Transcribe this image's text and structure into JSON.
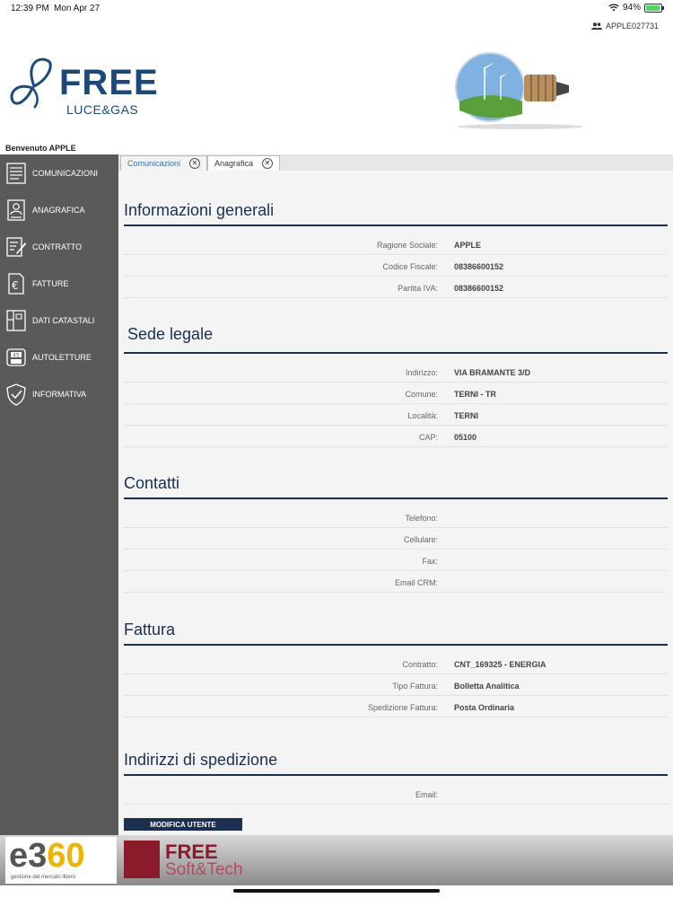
{
  "status": {
    "time": "12:39 PM",
    "date": "Mon Apr 27",
    "battery": "94%",
    "battery_level": 0.94
  },
  "user": {
    "code": "APPLE027731",
    "welcome": "Benvenuto APPLE"
  },
  "brand": {
    "primary": "#1b4a7a",
    "sidebar_bg": "#5a5a5a",
    "heading": "#1b2f4f"
  },
  "sidebar": {
    "items": [
      {
        "label": "COMUNICAZIONI",
        "icon": "document-list-icon"
      },
      {
        "label": "ANAGRAFICA",
        "icon": "id-card-icon"
      },
      {
        "label": "CONTRATTO",
        "icon": "contract-edit-icon"
      },
      {
        "label": "FATTURE",
        "icon": "euro-invoice-icon"
      },
      {
        "label": "DATI CATASTALI",
        "icon": "building-map-icon"
      },
      {
        "label": "AUTOLETTURE",
        "icon": "meter-icon"
      },
      {
        "label": "INFORMATIVA",
        "icon": "shield-check-icon"
      }
    ]
  },
  "tabs": [
    {
      "label": "Comunicazioni"
    },
    {
      "label": "Anagrafica"
    }
  ],
  "sections": {
    "generali": {
      "title": "Informazioni generali",
      "rows": [
        {
          "key": "Ragione Sociale:",
          "value": "APPLE"
        },
        {
          "key": "Codice Fiscale:",
          "value": "08386600152"
        },
        {
          "key": "Partita IVA:",
          "value": "08386600152"
        }
      ]
    },
    "sede": {
      "title": "Sede legale",
      "rows": [
        {
          "key": "Indirizzo:",
          "value": "VIA BRAMANTE 3/D"
        },
        {
          "key": "Comune:",
          "value": "TERNI - TR"
        },
        {
          "key": "Località:",
          "value": "TERNI"
        },
        {
          "key": "CAP:",
          "value": "05100"
        }
      ]
    },
    "contatti": {
      "title": "Contatti",
      "rows": [
        {
          "key": "Telefono:",
          "value": ""
        },
        {
          "key": "Cellulare:",
          "value": ""
        },
        {
          "key": "Fax:",
          "value": ""
        },
        {
          "key": "Email CRM:",
          "value": ""
        }
      ]
    },
    "fattura": {
      "title": "Fattura",
      "rows": [
        {
          "key": "Contratto:",
          "value": "CNT_169325 - ENERGIA"
        },
        {
          "key": "Tipo Fattura:",
          "value": "Bolletta Analitica"
        },
        {
          "key": "Spedizione Fattura:",
          "value": "Posta Ordinaria"
        }
      ]
    },
    "spedizione": {
      "title": "Indirizzi di spedizione",
      "rows": [
        {
          "key": "Email:",
          "value": ""
        }
      ]
    }
  },
  "actions": {
    "modifica": "MODIFICA UTENTE"
  },
  "logo": {
    "free": "FREE",
    "lucegas": "LUCE&GAS"
  },
  "footer": {
    "e360_a": "e3",
    "e360_b": "60",
    "e360_tag": "gestione del mercato libero",
    "fst_1": "FREE",
    "fst_2": "Soft&Tech"
  }
}
